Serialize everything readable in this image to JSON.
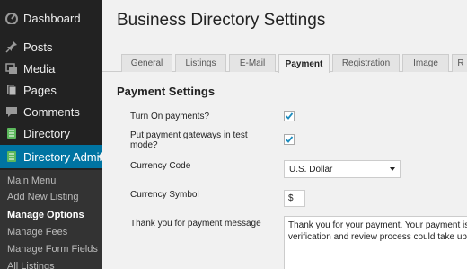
{
  "sidebar": {
    "items": [
      {
        "label": "Dashboard",
        "icon": "dashboard-icon"
      },
      {
        "label": "Posts",
        "icon": "pin-icon"
      },
      {
        "label": "Media",
        "icon": "media-icon"
      },
      {
        "label": "Pages",
        "icon": "pages-icon"
      },
      {
        "label": "Comments",
        "icon": "comments-icon"
      },
      {
        "label": "Directory",
        "icon": "directory-icon"
      },
      {
        "label": "Directory Admin",
        "icon": "directory-admin-icon"
      }
    ],
    "submenu": [
      {
        "label": "Main Menu"
      },
      {
        "label": "Add New Listing"
      },
      {
        "label": "Manage Options"
      },
      {
        "label": "Manage Fees"
      },
      {
        "label": "Manage Form Fields"
      },
      {
        "label": "All Listings"
      }
    ],
    "active_color": "#0074a2",
    "green_icon_color": "#5cb85c"
  },
  "page": {
    "title": "Business Directory Settings"
  },
  "tabs": [
    {
      "label": "General"
    },
    {
      "label": "Listings"
    },
    {
      "label": "E-Mail"
    },
    {
      "label": "Payment"
    },
    {
      "label": "Registration"
    },
    {
      "label": "Image"
    },
    {
      "label": "R"
    }
  ],
  "settings": {
    "section_title": "Payment Settings",
    "turn_on_payments": {
      "label": "Turn On payments?",
      "checked": true
    },
    "test_mode": {
      "label_line1": "Put payment gateways in test",
      "label_line2": "mode?",
      "checked": true
    },
    "currency_code": {
      "label": "Currency Code",
      "value": "U.S. Dollar"
    },
    "currency_symbol": {
      "label": "Currency Symbol",
      "value": "$"
    },
    "thank_you": {
      "label": "Thank you for payment message",
      "line1": "Thank you for your payment. Your payment is b",
      "line2": "verification and review process could take up to"
    }
  }
}
